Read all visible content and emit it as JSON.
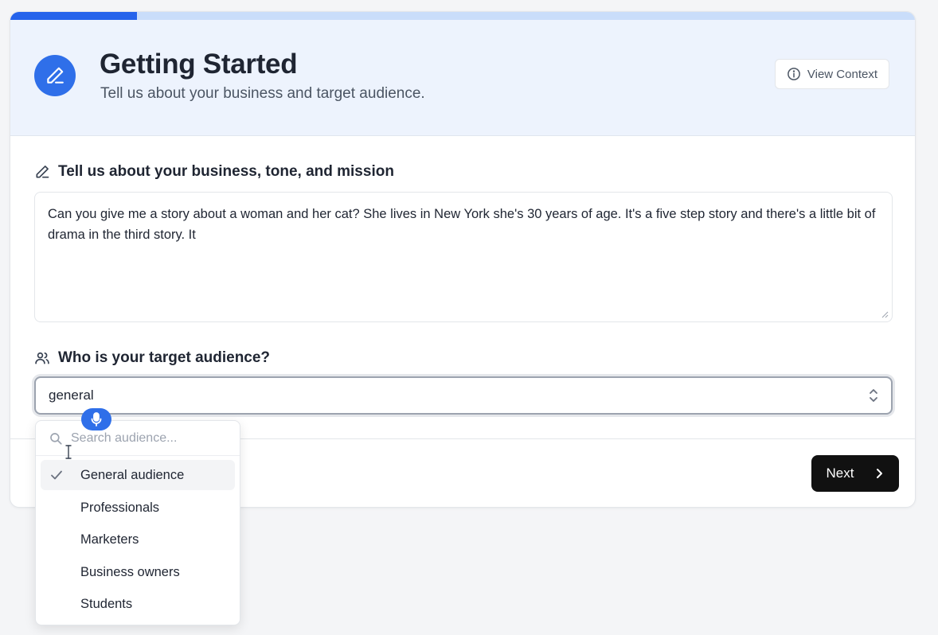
{
  "progress": {
    "value_percent": 14,
    "fill_color": "#2563eb",
    "track_color": "#c9ddfa"
  },
  "header": {
    "icon": "pencil-icon",
    "title": "Getting Started",
    "subtitle": "Tell us about your business and target audience.",
    "view_context_icon": "info-circle-icon",
    "view_context_label": "View Context"
  },
  "business": {
    "icon": "pencil-icon",
    "label": "Tell us about your business, tone, and mission",
    "value": "Can you give me a story about a woman and her cat? She lives in New York she's 30 years of age. It's a five step story and there's a little bit of drama in the third story. It"
  },
  "audience": {
    "icon": "users-icon",
    "label": "Who is your target audience?",
    "value": "general",
    "search_placeholder": "Search audience...",
    "options": [
      "General audience",
      "Professionals",
      "Marketers",
      "Business owners",
      "Students"
    ],
    "selected_index": 0
  },
  "footer": {
    "next_label": "Next",
    "next_icon": "chevron-right-icon"
  },
  "colors": {
    "accent": "#2f6fe9",
    "header_bg": "#edf3fd",
    "primary_button": "#111111"
  }
}
